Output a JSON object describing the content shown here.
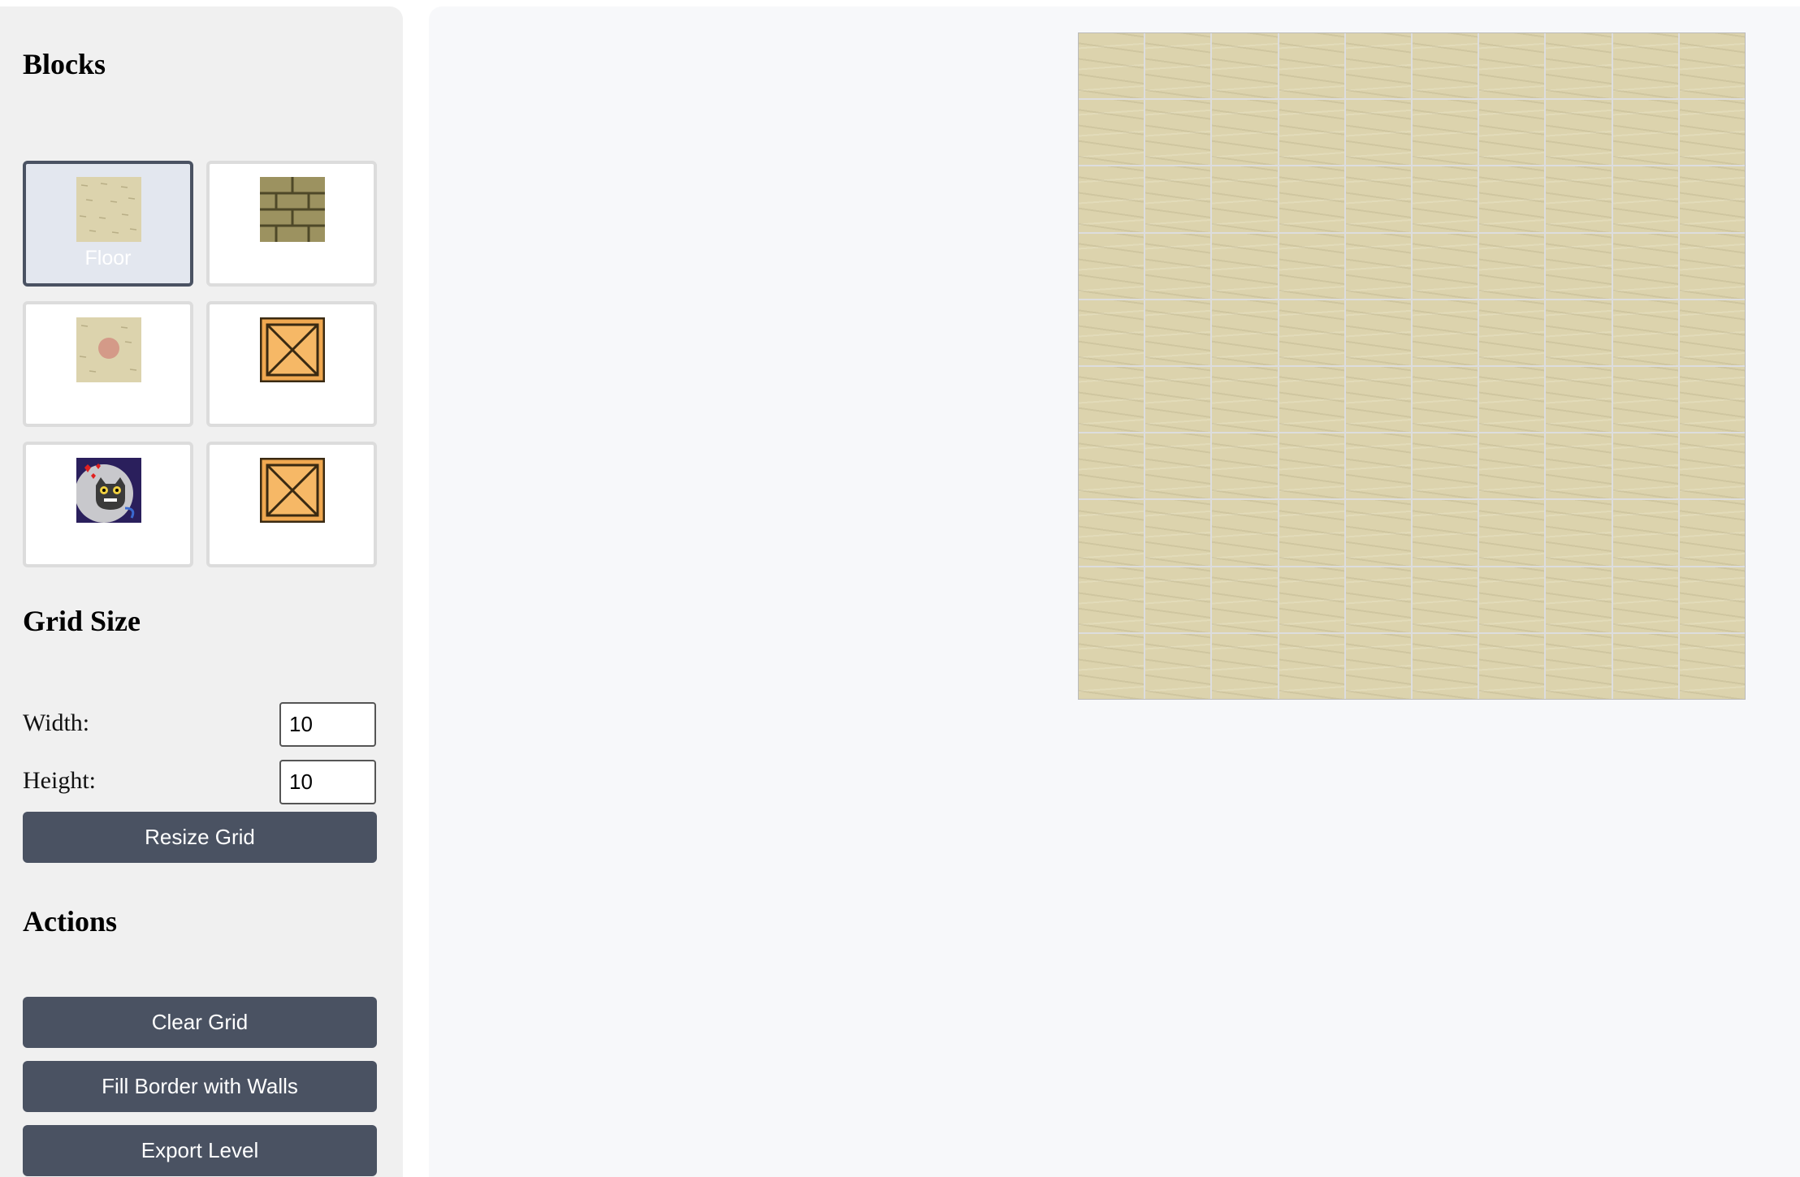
{
  "sidebar": {
    "blocks_heading": "Blocks",
    "blocks": [
      {
        "id": "floor",
        "label": "Floor",
        "icon": "floor-tile-icon",
        "selected": true
      },
      {
        "id": "wall",
        "label": "",
        "icon": "brick-wall-icon",
        "selected": false
      },
      {
        "id": "goal",
        "label": "",
        "icon": "goal-spot-icon",
        "selected": false
      },
      {
        "id": "box",
        "label": "",
        "icon": "crate-icon",
        "selected": false
      },
      {
        "id": "player",
        "label": "",
        "icon": "cat-player-icon",
        "selected": false
      },
      {
        "id": "box-on-goal",
        "label": "",
        "icon": "crate-icon",
        "selected": false
      }
    ],
    "grid_size_heading": "Grid Size",
    "width_label": "Width:",
    "width_value": "10",
    "height_label": "Height:",
    "height_value": "10",
    "resize_button": "Resize Grid",
    "actions_heading": "Actions",
    "clear_button": "Clear Grid",
    "fill_border_button": "Fill Border with Walls",
    "export_button": "Export Level"
  },
  "grid": {
    "columns": 10,
    "rows": 10,
    "fill": "floor"
  },
  "colors": {
    "button_bg": "#4a5262",
    "sidebar_bg": "#f0f0f0",
    "main_bg": "#f7f8fa",
    "floor": "#dcd3ad",
    "selected_tile_bg": "#e3e7ef"
  }
}
